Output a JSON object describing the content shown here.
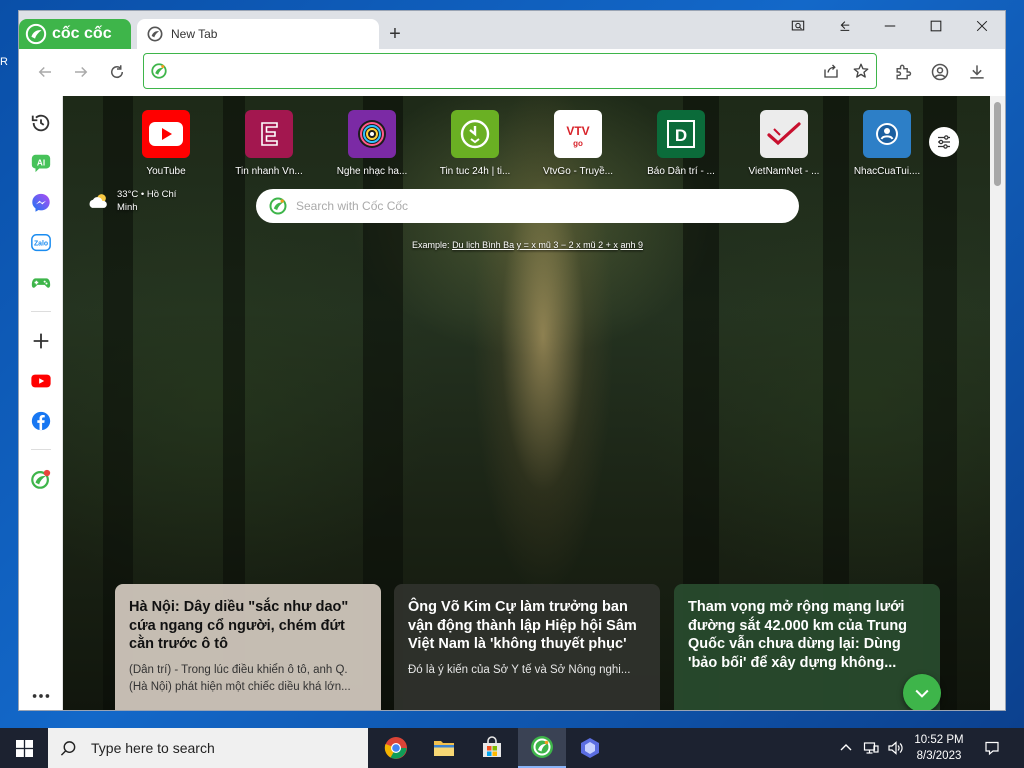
{
  "browser": {
    "brand_label": "cốc cốc",
    "tab_title": "New Tab",
    "omnibox_value": ""
  },
  "shortcuts": [
    {
      "label": "YouTube",
      "icon": "youtube-icon",
      "color": "#ff0000"
    },
    {
      "label": "Tin nhanh Vn...",
      "icon": "letter-e-icon",
      "color": "#a3174f"
    },
    {
      "label": "Nghe nhạc ha...",
      "icon": "music-disc-icon",
      "color": "#7b2aa5"
    },
    {
      "label": "Tin tuc 24h | ti...",
      "icon": "clock-24h-icon",
      "color": "#6ab023"
    },
    {
      "label": "VtvGo - Truyề...",
      "icon": "vtv-go-icon",
      "color": "#ffffff"
    },
    {
      "label": "Báo Dân trí - ...",
      "icon": "letter-d-icon",
      "color": "#0b6b3a"
    },
    {
      "label": "VietNamNet - ...",
      "icon": "vietnamnet-icon",
      "color": "#ececec"
    },
    {
      "label": "NhacCuaTui....",
      "icon": "nhaccuatui-icon",
      "color": "#2d7fc7"
    }
  ],
  "weather": {
    "temp_location": "33°C • Hồ Chí",
    "location_cont": "Minh"
  },
  "search": {
    "placeholder": "Search with Cốc Cốc",
    "example_prefix": "Example:",
    "example_links": [
      "Du lịch Bình Ba",
      "y = x mũ 3 − 2 x mũ 2 + x",
      "anh 9"
    ]
  },
  "news": [
    {
      "title": "Hà Nội: Dây diều \"sắc như dao\" cứa ngang cổ người, chém đứt cằn trước ô tô",
      "desc": "(Dân trí) - Trong lúc điều khiển ô tô, anh Q. (Hà Nội) phát hiện một chiếc diều khá lớn..."
    },
    {
      "title": "Ông Võ Kim Cự làm trưởng ban vận động thành lập Hiệp hội Sâm Việt Nam là 'không thuyết phục'",
      "desc": "Đó là ý kiến của Sở Y tế và Sở Nông nghi..."
    },
    {
      "title": "Tham vọng mở rộng mạng lưới đường sắt 42.000 km của Trung Quốc vẫn chưa dừng lại: Dùng 'bảo bối' để xây dựng không...",
      "desc": ""
    }
  ],
  "taskbar": {
    "search_placeholder": "Type here to search",
    "time": "10:52 PM",
    "date": "8/3/2023"
  },
  "colors": {
    "brand_green": "#3eb54a",
    "taskbar_bg": "#1c2230"
  }
}
